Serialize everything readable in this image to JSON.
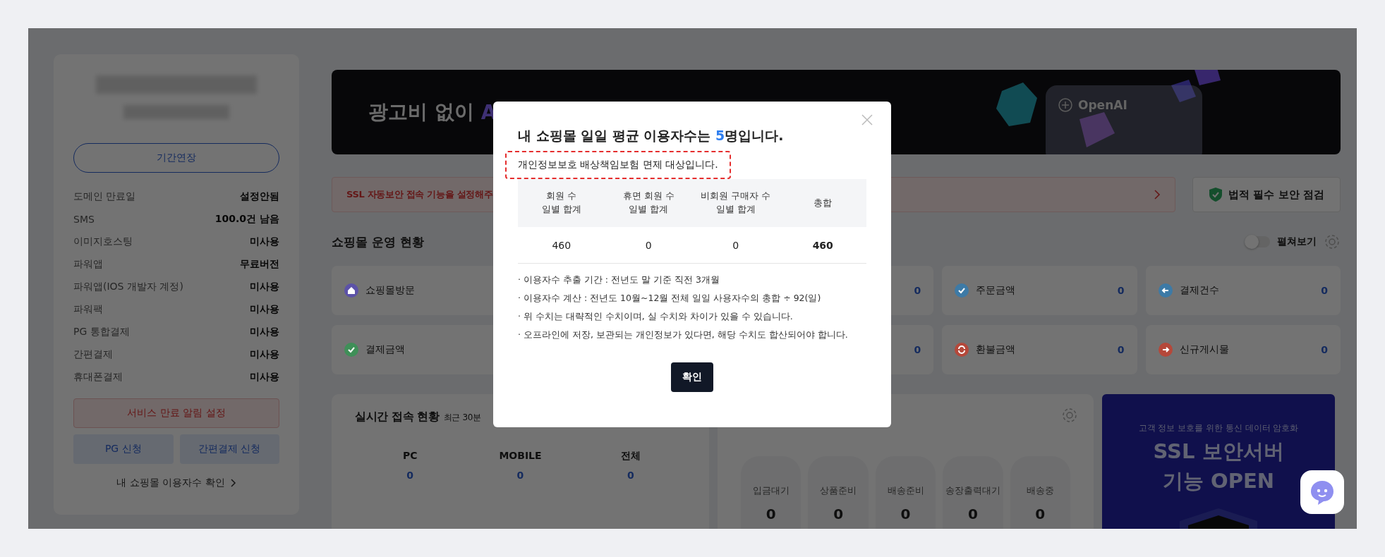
{
  "sidebar": {
    "extend_button": "기간연장",
    "info": [
      {
        "label": "도메인 만료일",
        "value": "설정안됨"
      },
      {
        "label": "SMS",
        "value": "100.0건 남음"
      },
      {
        "label": "이미지호스팅",
        "value": "미사용"
      },
      {
        "label": "파워앱",
        "value": "무료버전"
      },
      {
        "label": "파워앱(IOS 개발자 계정)",
        "value": "미사용"
      },
      {
        "label": "파워팩",
        "value": "미사용"
      },
      {
        "label": "PG 통합결제",
        "value": "미사용"
      },
      {
        "label": "간편결제",
        "value": "미사용"
      },
      {
        "label": "휴대폰결제",
        "value": "미사용"
      }
    ],
    "alert_button": "서비스 만료 알림 설정",
    "apply_buttons": [
      "PG 신청",
      "간편결제 신청"
    ],
    "user_count_link": "내 쇼핑몰 이용자수 확인"
  },
  "banner": {
    "headline": "광고비 없이",
    "headline_accent": "A",
    "badge": "OpenAI"
  },
  "ssl_notice": {
    "text": "SSL 자동보안 접속 기능을 설정해주",
    "button": "법적 필수 보안 점검"
  },
  "operations": {
    "title": "쇼핑몰 운영 현황",
    "toggle": {
      "label": "펼쳐보기",
      "on": false
    },
    "cards": [
      {
        "label": "쇼핑몰방문",
        "kind": "home",
        "color": "#5c52a8"
      },
      {
        "value": "0"
      },
      {
        "label": "주문금액",
        "value": "0",
        "kind": "check",
        "color": "#3d7aa6"
      },
      {
        "label": "결제건수",
        "value": "0",
        "kind": "back",
        "color": "#3d7aa6"
      },
      {
        "label": "결제금액",
        "kind": "check",
        "color": "#3f8f58"
      },
      {
        "value": "0"
      },
      {
        "label": "환불금액",
        "value": "0",
        "kind": "refresh",
        "color": "#b5483a"
      },
      {
        "label": "신규게시물",
        "value": "0",
        "kind": "forward",
        "color": "#b5483a"
      }
    ]
  },
  "realtime": {
    "title": "실시간 접속 현황",
    "subtitle": "최근 30분",
    "stats": [
      {
        "label": "PC",
        "value": "0"
      },
      {
        "label": "MOBILE",
        "value": "0"
      },
      {
        "label": "전체",
        "value": "0"
      }
    ]
  },
  "orders": {
    "stages": [
      {
        "label": "입금대기",
        "value": "0"
      },
      {
        "label": "상품준비",
        "value": "0"
      },
      {
        "label": "배송준비",
        "value": "0"
      },
      {
        "label": "송장출력대기",
        "value": "0"
      },
      {
        "label": "배송중",
        "value": "0"
      }
    ]
  },
  "ssl_promo": {
    "caption": "고객 정보 보호를 위한 통신 데이터 암호화",
    "title_lines": [
      "SSL 보안서버",
      "기능 OPEN"
    ]
  },
  "modal": {
    "title_prefix": "내 쇼핑몰 일일 평균 이용자수는 ",
    "count": "5",
    "title_suffix": "명입니다.",
    "notice": "개인정보보호 배상책임보험 면제 대상입니다.",
    "columns": [
      "회원 수\n일별 합계",
      "휴면 회원 수\n일별 합계",
      "비회원 구매자 수\n일별 합계",
      "총합"
    ],
    "values": [
      "460",
      "0",
      "0",
      "460"
    ],
    "notes": [
      "· 이용자수 추출 기간 : 전년도 말 기준 직전 3개월",
      "· 이용자수 계산 : 전년도 10월~12월 전체 일일 사용자수의 총합 ÷ 92(일)",
      "· 위 수치는 대략적인 수치이며, 실 수치와 차이가 있을 수 있습니다.",
      "· 오프라인에 저장, 보관되는 개인정보가 있다면, 해당 수치도 합산되어야 합니다."
    ],
    "confirm": "확인"
  }
}
